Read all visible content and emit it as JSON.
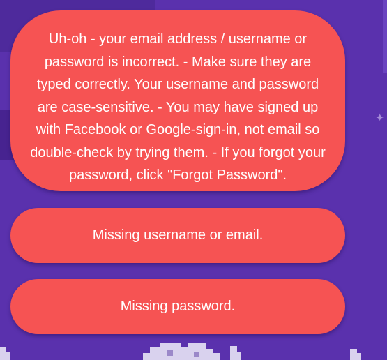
{
  "notifications": {
    "credentials_error": "Uh-oh - your email address / username or password is incorrect. - Make sure they are typed correctly. Your username and password are case-sensitive. - You may have signed up with Facebook or Google-sign-in, not email so double-check by trying them. - If you forgot your password, click \"Forgot Password\".",
    "missing_username": "Missing username or email.",
    "missing_password": "Missing password."
  },
  "colors": {
    "background": "#5a31ad",
    "toast": "#f65353",
    "text": "#ffffff"
  }
}
